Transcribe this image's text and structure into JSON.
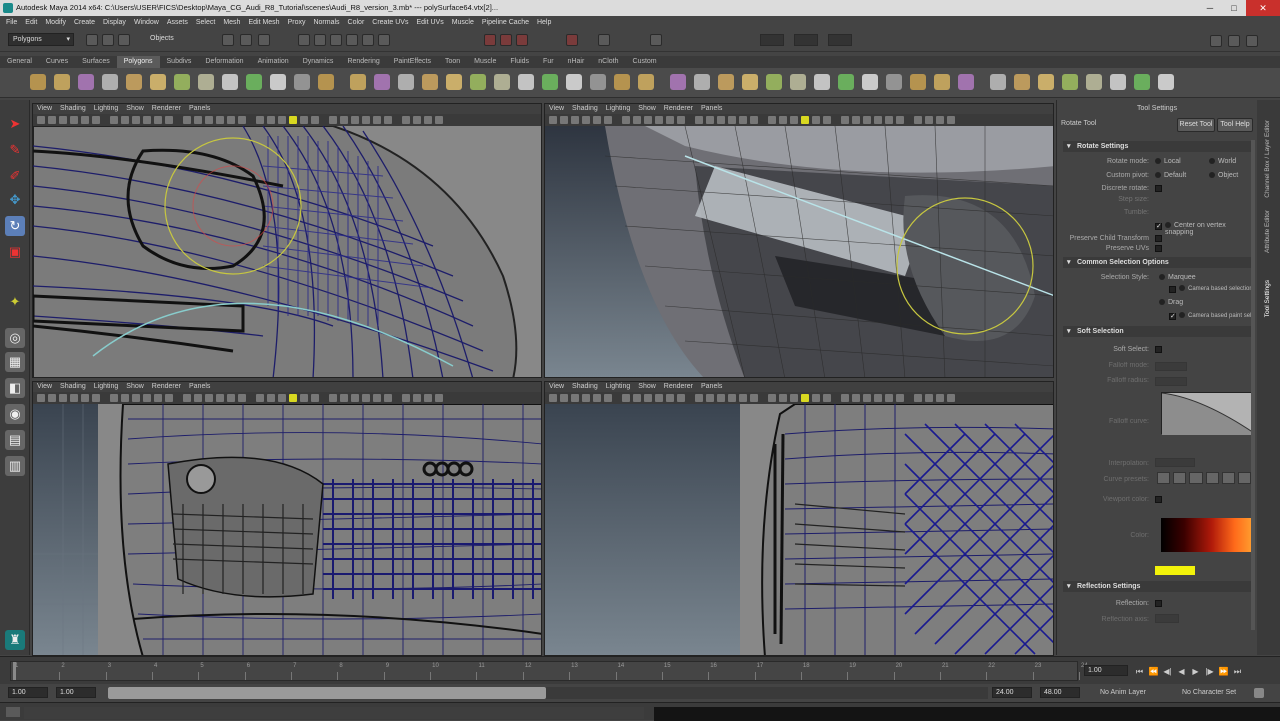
{
  "window": {
    "title": "Autodesk Maya 2014 x64: C:\\Users\\USER\\FICS\\Desktop\\Maya_CG_Audi_R8_Tutorial\\scenes\\Audi_R8_version_3.mb* --- polySurface64.vtx[2]...",
    "min": "─",
    "max": "□",
    "close": "✕"
  },
  "menu": [
    "File",
    "Edit",
    "Modify",
    "Create",
    "Display",
    "Window",
    "Assets",
    "Select",
    "Mesh",
    "Edit Mesh",
    "Proxy",
    "Normals",
    "Color",
    "Create UVs",
    "Edit UVs",
    "Muscle",
    "Pipeline Cache",
    "Help"
  ],
  "status": {
    "mode": "Polygons",
    "objects": "Objects"
  },
  "shelf_tabs": [
    "General",
    "Curves",
    "Surfaces",
    "Polygons",
    "Subdivs",
    "Deformation",
    "Animation",
    "Dynamics",
    "Rendering",
    "PaintEffects",
    "Toon",
    "Muscle",
    "Fluids",
    "Fur",
    "nHair",
    "nCloth",
    "Custom"
  ],
  "shelf_active": "Polygons",
  "viewports": [
    {
      "menu": [
        "View",
        "Shading",
        "Lighting",
        "Show",
        "Renderer",
        "Panels"
      ]
    },
    {
      "menu": [
        "View",
        "Shading",
        "Lighting",
        "Show",
        "Renderer",
        "Panels"
      ]
    },
    {
      "menu": [
        "View",
        "Shading",
        "Lighting",
        "Show",
        "Renderer",
        "Panels"
      ]
    },
    {
      "menu": [
        "View",
        "Shading",
        "Lighting",
        "Show",
        "Renderer",
        "Panels"
      ]
    }
  ],
  "tool_settings": {
    "header": "Tool Settings",
    "tool_name": "Rotate Tool",
    "reset": "Reset Tool",
    "help": "Tool Help",
    "sections": {
      "rotate": "Rotate Settings",
      "common": "Common Selection Options",
      "soft": "Soft Selection",
      "reflection": "Reflection Settings"
    },
    "rotate_mode": {
      "label": "Rotate mode:",
      "options": [
        "Local",
        "World",
        "Gimbal"
      ]
    },
    "custom_pivot": {
      "label": "Custom pivot:",
      "options": [
        "Default",
        "Object"
      ]
    },
    "discrete": "Discrete rotate:",
    "step": "Step size:",
    "tumble": "Tumble:",
    "center_pivot": "Center on vertex snapping",
    "preserve_child": "Preserve Child Transform",
    "preserve_uvs": "Preserve UVs",
    "sel_style": {
      "label": "Selection Style:",
      "opt1": "Marquee",
      "opt2": "Drag",
      "c1": "Camera based selection",
      "c2": "Camera based paint sel"
    },
    "soft_sel": "Soft Select:",
    "falloff_mode": "Falloff mode:",
    "falloff_radius": "Falloff radius:",
    "falloff_curve": "Falloff curve:",
    "interp": "Interpolation:",
    "presets": "Curve presets:",
    "viewport_color": "Viewport color:",
    "color_ramp": "Color:",
    "reflection": "Reflection:",
    "refl_axis": "Reflection axis:"
  },
  "right_strip": [
    "Channel Box / Layer Editor",
    "Attribute Editor",
    "Tool Settings"
  ],
  "time": {
    "start": "1.00",
    "current": "1.00",
    "range_start": "1.00",
    "range_start2": "1.00",
    "range_end": "24.00",
    "end": "48.00",
    "anim_layer": "No Anim Layer",
    "char_set": "No Character Set",
    "frame": "1.00"
  },
  "ticks": [
    "1",
    "2",
    "3",
    "4",
    "5",
    "6",
    "7",
    "8",
    "9",
    "10",
    "11",
    "12",
    "13",
    "14",
    "15",
    "16",
    "17",
    "18",
    "19",
    "20",
    "21",
    "22",
    "23",
    "24"
  ]
}
